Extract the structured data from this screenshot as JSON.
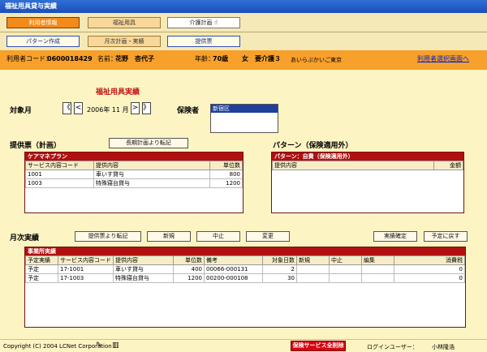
{
  "window": {
    "title": "福祉用具貸与実績"
  },
  "nav": {
    "row1": [
      "利用者情報",
      "福祉用具",
      "介護計画"
    ],
    "row2": [
      "パターン作成",
      "月次計画・実績",
      "提供票"
    ]
  },
  "info": {
    "user_code_label": "利用者コード：",
    "user_code": "0600018429",
    "name_label": "名前：",
    "name": "花野　杏代子",
    "age_label": "年齢：",
    "age": "70歳",
    "sex": "女",
    "care_level": "要介護３",
    "office": "あいらぶかいご東京",
    "select_link": "利用者選択画面へ"
  },
  "main": {
    "title": "福祉用具実績",
    "target_month_label": "対象月",
    "pager": {
      "first": "《",
      "prev": "<",
      "next": ">",
      "last": "》"
    },
    "month": "2006年 11 月",
    "insurer_label": "保険者",
    "insurer_selected": "新宿区",
    "plan_label": "提供票（計画）",
    "copy_long_term_btn": "長期計画より転記",
    "pattern_label": "パターン（保険適用外）",
    "caremanager_panel": {
      "header": "ケアマネプラン",
      "columns": [
        "サービス内容コード",
        "提供内容",
        "単位数"
      ],
      "rows": [
        {
          "code": "1001",
          "content": "車いす貸与",
          "units": "800"
        },
        {
          "code": "1003",
          "content": "特殊寝台貸与",
          "units": "1200"
        }
      ]
    },
    "pattern_panel": {
      "header": "パターン：自費（保険適用外）",
      "columns": [
        "提供内容",
        "金額"
      ]
    },
    "monthly_label": "月次実績",
    "buttons": {
      "copy_from_plan": "提供票より転記",
      "new": "新規",
      "cancel": "中止",
      "change": "変更",
      "confirm": "実績確定",
      "revert": "予定に戻す"
    },
    "office_panel": {
      "header": "事業所実績",
      "columns": [
        "予定実績",
        "サービス内容コード",
        "提供内容",
        "単位数",
        "備考",
        "対象日数",
        "新規",
        "中止",
        "編集",
        "消費税"
      ],
      "rows": [
        {
          "status": "予定",
          "code": "17-1001",
          "content": "車いす貸与",
          "units": "400",
          "note": "00066-000131",
          "days": "2",
          "new": "",
          "stop": "",
          "edit": "",
          "tax": "0"
        },
        {
          "status": "予定",
          "code": "17-1003",
          "content": "特殊寝台貸与",
          "units": "1200",
          "note": "00200-000108",
          "days": "30",
          "new": "",
          "stop": "",
          "edit": "",
          "tax": "0"
        }
      ]
    }
  },
  "status": {
    "copyright": "Copyright (C) 2004 LCNet Corporation",
    "delete_all_btn": "保険サービス全削除",
    "login_label": "ログインユーザー：",
    "login_user": "小林隆浩"
  }
}
